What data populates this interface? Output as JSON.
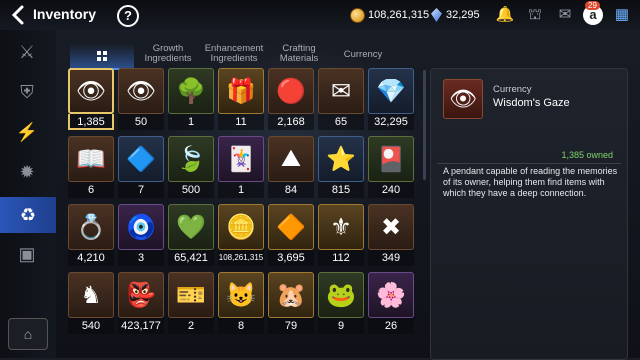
{
  "header": {
    "title": "Inventory",
    "help_label": "?",
    "gold": "108,261,315",
    "crystals": "32,295",
    "mail_badge": "29"
  },
  "tabs": [
    {
      "label": "",
      "icon": "grid-icon",
      "active": true
    },
    {
      "label": "Growth\nIngredients"
    },
    {
      "label": "Enhancement\nIngredients"
    },
    {
      "label": "Crafting\nMaterials"
    },
    {
      "label": "Currency"
    }
  ],
  "sidebar": {
    "items": [
      {
        "icon": "sword-shield-icon",
        "glyph": "⚔"
      },
      {
        "icon": "artifact-icon",
        "glyph": "🛡"
      },
      {
        "icon": "lightning-icon",
        "glyph": "⚡"
      },
      {
        "icon": "gear-cog-icon",
        "glyph": "⚙"
      },
      {
        "icon": "materials-icon",
        "glyph": "♻",
        "active": true
      },
      {
        "icon": "chest-icon",
        "glyph": "▦"
      }
    ],
    "bottom": {
      "icon": "storage-icon",
      "glyph": "⌂"
    }
  },
  "items": [
    {
      "count": "1,385",
      "glyph": "👁",
      "color": "red",
      "selected": true
    },
    {
      "count": "50",
      "glyph": "👁",
      "color": "red"
    },
    {
      "count": "1",
      "glyph": "🌳",
      "color": "red"
    },
    {
      "count": "11",
      "glyph": "🎁",
      "color": "red"
    },
    {
      "count": "2,168",
      "glyph": "🔴",
      "color": "red"
    },
    {
      "count": "65",
      "glyph": "✉",
      "color": "red"
    },
    {
      "count": "32,295",
      "glyph": "💎",
      "color": "red"
    },
    {
      "count": "6",
      "glyph": "📖",
      "color": "red"
    },
    {
      "count": "7",
      "glyph": "🔷",
      "color": "red"
    },
    {
      "count": "500",
      "glyph": "🍃",
      "color": "red"
    },
    {
      "count": "1",
      "glyph": "🃏",
      "color": "red"
    },
    {
      "count": "84",
      "glyph": "⛰",
      "color": "red"
    },
    {
      "count": "815",
      "glyph": "⭐",
      "color": "red"
    },
    {
      "count": "240",
      "glyph": "🎴",
      "color": "red"
    },
    {
      "count": "4,210",
      "glyph": "💍",
      "color": "red"
    },
    {
      "count": "3",
      "glyph": "🧿",
      "color": "red"
    },
    {
      "count": "65,421",
      "glyph": "💚",
      "color": "red"
    },
    {
      "count": "108,261,315",
      "glyph": "🪙",
      "color": "red"
    },
    {
      "count": "3,695",
      "glyph": "🔶",
      "color": "red"
    },
    {
      "count": "112",
      "glyph": "⚜",
      "color": "red"
    },
    {
      "count": "349",
      "glyph": "✖",
      "color": "red"
    },
    {
      "count": "540",
      "glyph": "♞",
      "color": "red"
    },
    {
      "count": "423,177",
      "glyph": "👺",
      "color": "red"
    },
    {
      "count": "2",
      "glyph": "🎫",
      "color": "red"
    },
    {
      "count": "8",
      "glyph": "😺",
      "color": "red"
    },
    {
      "count": "79",
      "glyph": "🐹",
      "color": "red"
    },
    {
      "count": "9",
      "glyph": "🐸",
      "color": "red"
    },
    {
      "count": "26",
      "glyph": "🌸",
      "color": "red"
    }
  ],
  "detail": {
    "category": "Currency",
    "name": "Wisdom's Gaze",
    "owned": "1,385 owned",
    "description": "A pendant capable of reading the memories of its owner, helping them find items with which they have a deep connection.",
    "glyph": "👁"
  }
}
